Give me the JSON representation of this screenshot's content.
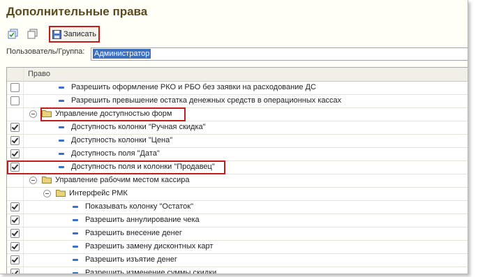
{
  "window": {
    "title": "Дополнительные права"
  },
  "toolbar": {
    "save_label": "Записать"
  },
  "user": {
    "label": "Пользователь/Группа:",
    "value": "Администратор"
  },
  "grid": {
    "header": "Право",
    "rows": [
      {
        "checked": false,
        "kind": "item",
        "level": 3,
        "label": "Разрешить оформление РКО и РБО без заявки на расходование ДС"
      },
      {
        "checked": false,
        "kind": "item",
        "level": 3,
        "label": "Разрешить превышение остатка денежных средств в операционных кассах"
      },
      {
        "checked": null,
        "kind": "group",
        "level": 1,
        "label": "Управление доступностью форм"
      },
      {
        "checked": true,
        "kind": "item",
        "level": 3,
        "label": "Доступность колонки \"Ручная скидка\""
      },
      {
        "checked": true,
        "kind": "item",
        "level": 3,
        "label": "Доступность колонки \"Цена\""
      },
      {
        "checked": true,
        "kind": "item",
        "level": 3,
        "label": "Доступность поля \"Дата\""
      },
      {
        "checked": true,
        "kind": "item",
        "level": 3,
        "label": "Доступность поля и колонки \"Продавец\""
      },
      {
        "checked": null,
        "kind": "group",
        "level": 1,
        "label": "Управление рабочим местом кассира"
      },
      {
        "checked": null,
        "kind": "group",
        "level": 2,
        "label": "Интерфейс РМК"
      },
      {
        "checked": true,
        "kind": "item",
        "level": 4,
        "label": "Показывать колонку \"Остаток\""
      },
      {
        "checked": true,
        "kind": "item",
        "level": 4,
        "label": "Разрешить аннулирование чека"
      },
      {
        "checked": true,
        "kind": "item",
        "level": 4,
        "label": "Разрешить внесение денег"
      },
      {
        "checked": true,
        "kind": "item",
        "level": 4,
        "label": "Разрешить замену дисконтных карт"
      },
      {
        "checked": true,
        "kind": "item",
        "level": 4,
        "label": "Разрешить изъятие денег"
      },
      {
        "checked": true,
        "kind": "item",
        "level": 4,
        "label": "Разрешить изменение суммы скидки"
      }
    ]
  },
  "colors": {
    "highlight": "#c21d1d",
    "selection": "#3d6fbf",
    "title": "#5b4a1e"
  }
}
